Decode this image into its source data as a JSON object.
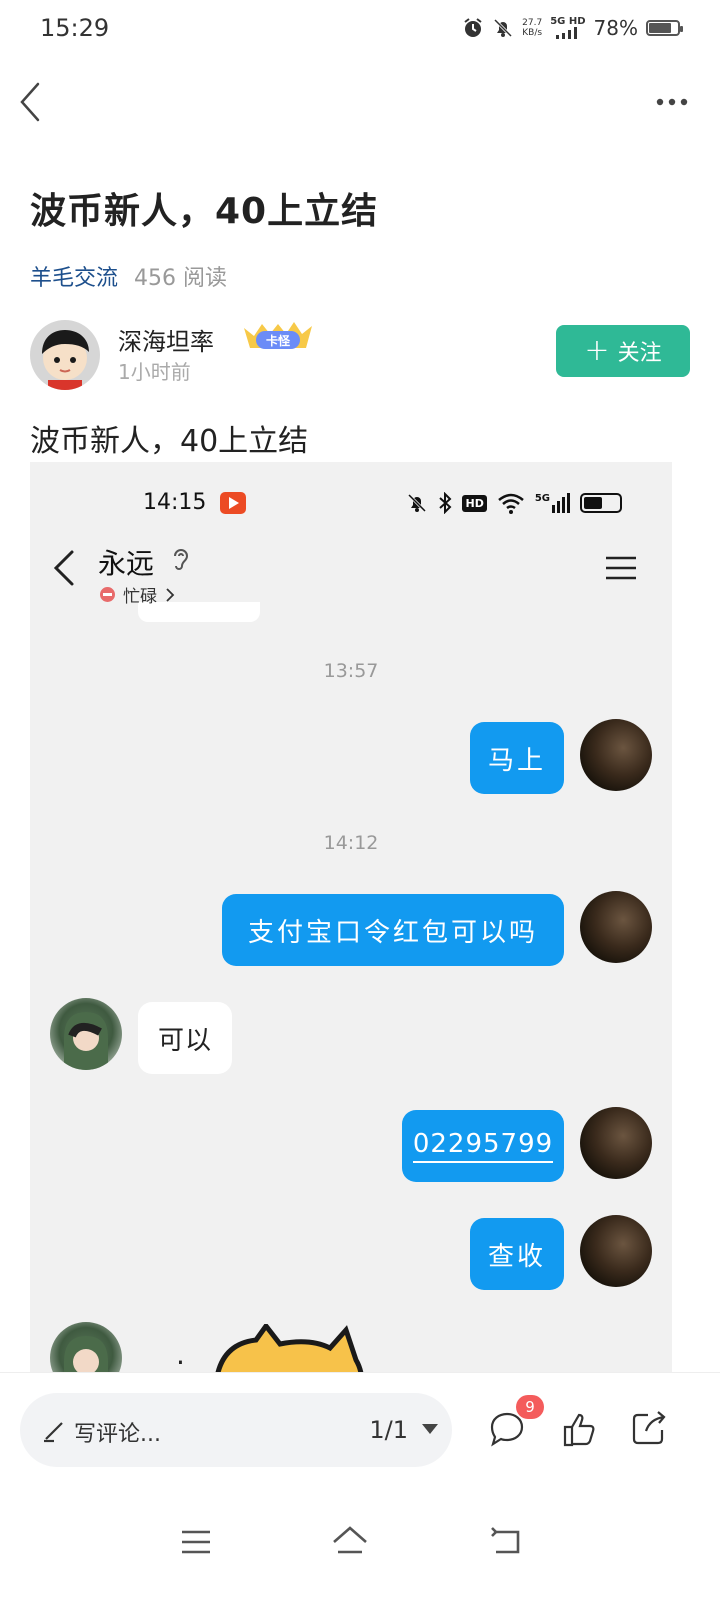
{
  "status_bar": {
    "time": "15:29",
    "net_speed_value": "27.7",
    "net_speed_unit": "KB/s",
    "signal_label": "5G HD",
    "battery_percent": "78%",
    "battery_level": 0.78
  },
  "article": {
    "title": "波币新人，40上立结",
    "category": "羊毛交流",
    "reads": "456 阅读",
    "author": {
      "name": "深海坦率",
      "badge_label": "卡怪",
      "time": "1小时前",
      "follow_label": "关注"
    },
    "body": "波币新人，40上立结"
  },
  "screenshot": {
    "status_time": "14:15",
    "status_hd": "HD",
    "status_signal": "5G",
    "contact_name": "永远",
    "contact_status": "忙碌",
    "timestamps": [
      "13:57",
      "14:12"
    ],
    "messages": [
      {
        "side": "out",
        "text": "马上"
      },
      {
        "side": "out",
        "text": "支付宝口令红包可以吗"
      },
      {
        "side": "in",
        "text": "可以"
      },
      {
        "side": "out",
        "text": "02295799"
      },
      {
        "side": "out",
        "text": "查收"
      }
    ],
    "accent_color": "#129af0"
  },
  "bottom_bar": {
    "comment_placeholder": "写评论...",
    "pager": "1/1",
    "comment_count": "9"
  },
  "colors": {
    "follow": "#2fb996",
    "category": "#1d4f8c",
    "badge": "#f45c5c"
  },
  "icons": [
    "back-icon",
    "more-icon",
    "comment-icon",
    "like-icon",
    "share-icon",
    "menu-icon",
    "home-icon",
    "return-icon"
  ]
}
